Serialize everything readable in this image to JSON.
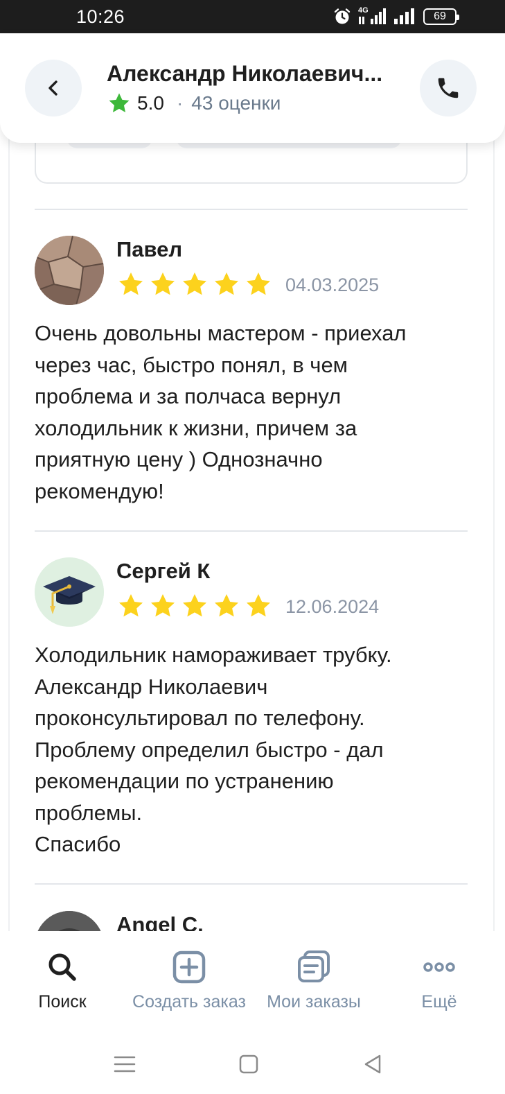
{
  "status_bar": {
    "time": "10:26",
    "network": "4G",
    "battery": "69",
    "icons": [
      "alarm-icon",
      "signal-icon",
      "signal-icon",
      "battery-icon"
    ]
  },
  "header": {
    "title": "Александр Николаевич...",
    "rating": "5.0",
    "separator": "·",
    "rating_count": "43 оценки",
    "back_icon": "chevron-left-icon",
    "call_icon": "phone-icon",
    "star_color": "#3db83a"
  },
  "reviews": [
    {
      "name": "Павел",
      "stars": 5,
      "date": "04.03.2025",
      "text": "Очень довольны мастером - приехал\nчерез час, быстро понял, в чем\nпроблема и за полчаса вернул\nхолодильник к жизни, причем за\nприятную цену ) Однозначно\nрекомендую!",
      "avatar": "stone-wall-photo"
    },
    {
      "name": "Сергей К",
      "stars": 5,
      "date": "12.06.2024",
      "text": "Холодильник намораживает трубку.\nАлександр Николаевич\nпроконсультировал по телефону.\nПроблему определил быстро - дал\nрекомендации по устранению\nпроблемы.\nСпасибо",
      "avatar": "graduation-cap-icon"
    },
    {
      "name": "Angel C.",
      "avatar": "dark-photo"
    }
  ],
  "star_color": "#fcd21d",
  "bottom_nav": [
    {
      "label": "Поиск",
      "icon": "search-icon",
      "active": true
    },
    {
      "label": "Создать заказ",
      "icon": "plus-square-icon",
      "active": false
    },
    {
      "label": "Мои заказы",
      "icon": "orders-icon",
      "active": false
    },
    {
      "label": "Ещё",
      "icon": "more-icon",
      "active": false
    }
  ],
  "nav_colors": {
    "active": "#1f1f1f",
    "inactive": "#7b8fa6"
  },
  "system_nav": [
    "menu-icon",
    "home-icon",
    "back-icon"
  ]
}
